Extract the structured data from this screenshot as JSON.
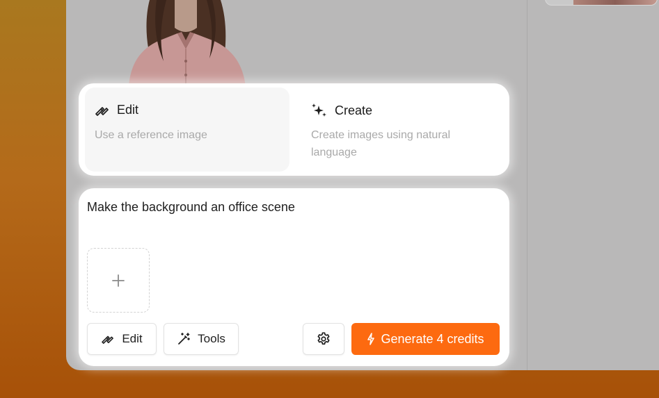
{
  "modes": {
    "edit": {
      "title": "Edit",
      "description": "Use a reference image",
      "icon": "pen-pencil-icon",
      "selected": true
    },
    "create": {
      "title": "Create",
      "description": "Create images using natural language",
      "icon": "sparkles-icon"
    }
  },
  "prompt": {
    "value": "Make the background an office scene"
  },
  "upload": {
    "icon": "plus-icon"
  },
  "toolbar": {
    "edit_label": "Edit",
    "tools_label": "Tools",
    "settings_icon": "gear-icon",
    "generate_label": "Generate 4 credits",
    "generate_icon": "lightning-icon"
  },
  "colors": {
    "accent": "#fd6a10",
    "muted_text": "#a9a9a9",
    "background_overlay": "#b9b8b8"
  }
}
